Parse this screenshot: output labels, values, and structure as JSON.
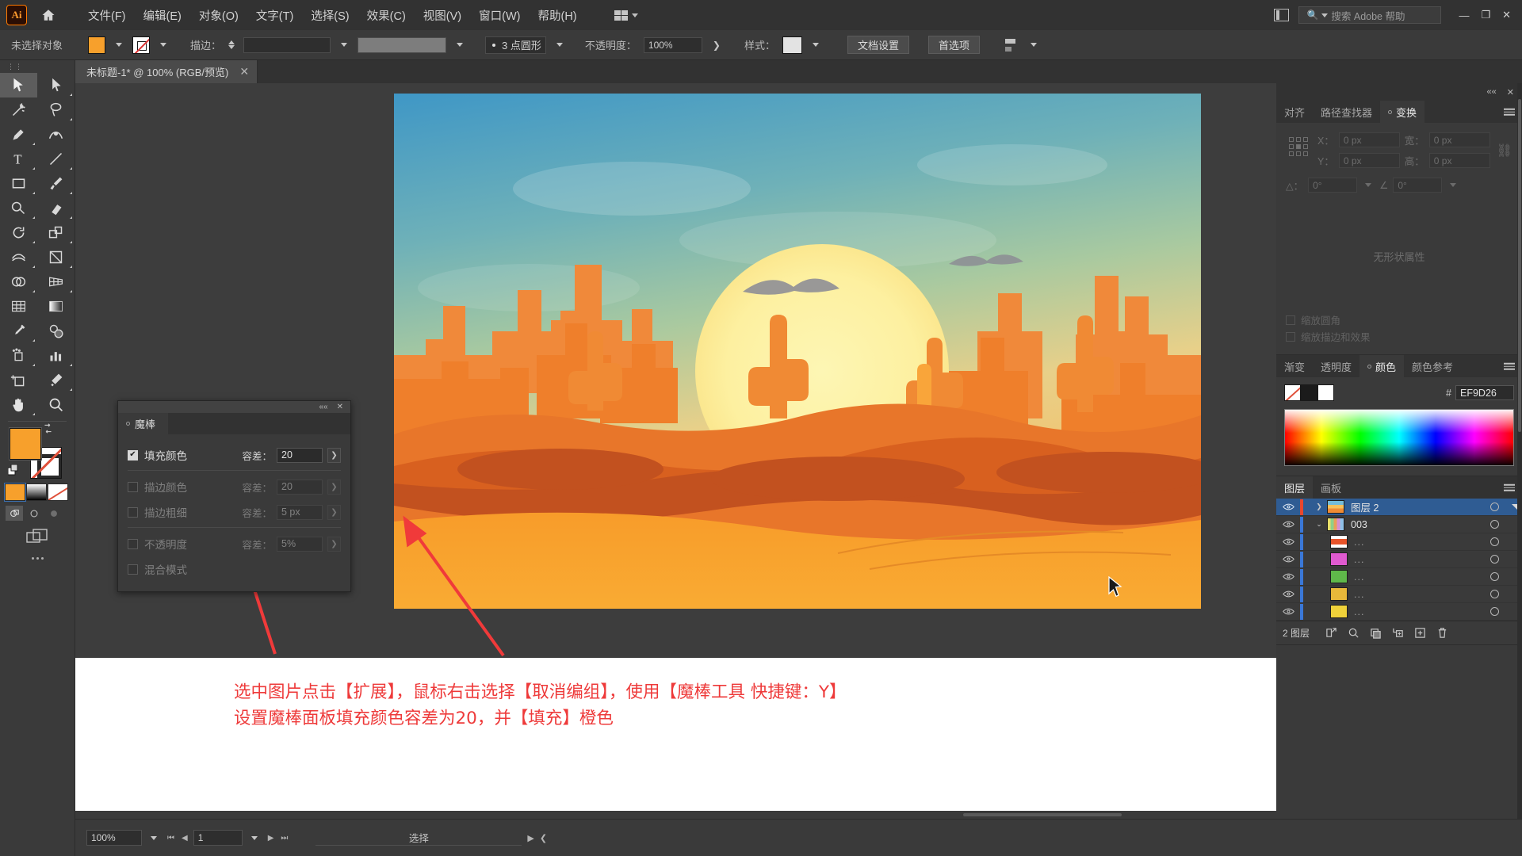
{
  "app": {
    "logo": "Ai",
    "home_icon": "home-icon"
  },
  "menu": {
    "items": [
      {
        "label": "文件(F)"
      },
      {
        "label": "编辑(E)"
      },
      {
        "label": "对象(O)"
      },
      {
        "label": "文字(T)"
      },
      {
        "label": "选择(S)"
      },
      {
        "label": "效果(C)"
      },
      {
        "label": "视图(V)"
      },
      {
        "label": "窗口(W)"
      },
      {
        "label": "帮助(H)"
      }
    ],
    "workspace_switcher": "workspace-switcher"
  },
  "titlebar": {
    "search_placeholder": "搜索 Adobe 帮助",
    "minimize": "—",
    "restore": "❐",
    "close": "✕"
  },
  "control_bar": {
    "selection_status": "未选择对象",
    "fill_color": "#F7A02C",
    "stroke_label": "描边：",
    "stroke_weight": "",
    "profile_label": "3 点圆形",
    "opacity_label": "不透明度：",
    "opacity_value": "100%",
    "style_label": "样式：",
    "document_setup": "文档设置",
    "preferences": "首选项"
  },
  "document_tab": {
    "title": "未标题-1* @ 100% (RGB/预览)",
    "close": "✕"
  },
  "toolbar": {
    "tools": [
      {
        "name": "selection-tool",
        "selected": true
      },
      {
        "name": "direct-selection-tool",
        "selected": false
      },
      {
        "name": "magic-wand-tool",
        "selected": false
      },
      {
        "name": "lasso-tool",
        "selected": false
      },
      {
        "name": "pen-tool",
        "selected": false
      },
      {
        "name": "curvature-tool",
        "selected": false
      },
      {
        "name": "type-tool",
        "selected": false
      },
      {
        "name": "line-segment-tool",
        "selected": false
      },
      {
        "name": "rectangle-tool",
        "selected": false
      },
      {
        "name": "paintbrush-tool",
        "selected": false
      },
      {
        "name": "shaper-tool",
        "selected": false
      },
      {
        "name": "eraser-tool",
        "selected": false
      },
      {
        "name": "rotate-tool",
        "selected": false
      },
      {
        "name": "scale-tool",
        "selected": false
      },
      {
        "name": "width-tool",
        "selected": false
      },
      {
        "name": "free-transform-tool",
        "selected": false
      },
      {
        "name": "shape-builder-tool",
        "selected": false
      },
      {
        "name": "perspective-grid-tool",
        "selected": false
      },
      {
        "name": "mesh-tool",
        "selected": false
      },
      {
        "name": "gradient-tool",
        "selected": false
      },
      {
        "name": "eyedropper-tool",
        "selected": false
      },
      {
        "name": "blend-tool",
        "selected": false
      },
      {
        "name": "symbol-sprayer-tool",
        "selected": false
      },
      {
        "name": "column-graph-tool",
        "selected": false
      },
      {
        "name": "artboard-tool",
        "selected": false
      },
      {
        "name": "slice-tool",
        "selected": false
      },
      {
        "name": "hand-tool",
        "selected": false
      },
      {
        "name": "zoom-tool",
        "selected": false
      }
    ],
    "fill_swatch": "#F7A02C",
    "stroke_swatch": "#FFFFFF",
    "color_modes": [
      "color-fill-mode",
      "gradient-mode",
      "none-mode"
    ],
    "draw_modes": [
      "draw-normal",
      "draw-behind",
      "draw-inside"
    ],
    "screen_mode": "screen-mode-button",
    "more_tools": "•••"
  },
  "magic_wand_panel": {
    "tab_label": "魔棒",
    "collapse_icon": "««",
    "close_icon": "✕",
    "rows": [
      {
        "label": "填充颜色",
        "checked": true,
        "tolerance_label": "容差：",
        "tolerance_value": "20",
        "enabled": true
      },
      {
        "label": "描边颜色",
        "checked": false,
        "tolerance_label": "容差：",
        "tolerance_value": "20",
        "enabled": false
      },
      {
        "label": "描边粗细",
        "checked": false,
        "tolerance_label": "容差：",
        "tolerance_value": "5 px",
        "enabled": false
      },
      {
        "label": "不透明度",
        "checked": false,
        "tolerance_label": "容差：",
        "tolerance_value": "5%",
        "enabled": false
      },
      {
        "label": "混合模式",
        "checked": false,
        "tolerance_label": "",
        "tolerance_value": "",
        "enabled": false
      }
    ]
  },
  "transform_panel": {
    "tabs": [
      {
        "label": "对齐",
        "active": false
      },
      {
        "label": "路径查找器",
        "active": false
      },
      {
        "label": "变换",
        "active": true
      }
    ],
    "x_label": "X：",
    "x_value": "0 px",
    "y_label": "Y：",
    "y_value": "0 px",
    "w_label": "宽：",
    "w_value": "0 px",
    "h_label": "高：",
    "h_value": "0 px",
    "angle_label": "△：",
    "angle_value": "0°",
    "shear_value": "0°",
    "empty_text": "无形状属性",
    "check_scale": "缩放圆角",
    "check_strokes": "缩放描边和效果",
    "link_icon": "constrain-proportions-icon",
    "menu_icon": "panel-menu-icon"
  },
  "color_panel": {
    "tabs": [
      {
        "label": "渐变",
        "active": false
      },
      {
        "label": "透明度",
        "active": false
      },
      {
        "label": "颜色",
        "active": true
      },
      {
        "label": "颜色参考",
        "active": false
      }
    ],
    "hex_symbol": "#",
    "hex_value": "EF9D26",
    "menu_icon": "panel-menu-icon"
  },
  "layers_panel": {
    "tabs": [
      {
        "label": "图层",
        "active": true
      },
      {
        "label": "画板",
        "active": false
      }
    ],
    "rows": [
      {
        "name": "图层 2",
        "selected": true,
        "color": "#e8472e",
        "indent": 0,
        "expandable": true,
        "expanded": false,
        "thumb": "artwork-thumbnail",
        "visible": true
      },
      {
        "name": "003",
        "selected": false,
        "color": "#3a78d8",
        "indent": 1,
        "expandable": true,
        "expanded": true,
        "thumb": "group-thumbnail",
        "visible": true
      },
      {
        "name": "...",
        "selected": false,
        "color": "#3a78d8",
        "indent": 2,
        "expandable": false,
        "expanded": false,
        "thumb": "#e8542a",
        "visible": true
      },
      {
        "name": "...",
        "selected": false,
        "color": "#3a78d8",
        "indent": 2,
        "expandable": false,
        "expanded": false,
        "thumb": "#e05ad0",
        "visible": true
      },
      {
        "name": "...",
        "selected": false,
        "color": "#3a78d8",
        "indent": 2,
        "expandable": false,
        "expanded": false,
        "thumb": "#5fb84a",
        "visible": true
      },
      {
        "name": "...",
        "selected": false,
        "color": "#3a78d8",
        "indent": 2,
        "expandable": false,
        "expanded": false,
        "thumb": "#e8b83a",
        "visible": true
      },
      {
        "name": "...",
        "selected": false,
        "color": "#3a78d8",
        "indent": 2,
        "expandable": false,
        "expanded": false,
        "thumb": "#f0d23a",
        "visible": true
      }
    ],
    "footer_count": "2 图层",
    "footer_buttons": [
      {
        "name": "locate-object-button"
      },
      {
        "name": "make-clipping-mask-button"
      },
      {
        "name": "create-new-sublayer-button"
      },
      {
        "name": "create-new-layer-button"
      },
      {
        "name": "delete-selection-button"
      }
    ]
  },
  "annotation": {
    "line1": "选中图片点击【扩展】，鼠标右击选择【取消编组】，使用【魔棒工具 快捷键：Y】",
    "line2": "设置魔棒面板填充颜色容差为20，并【填充】橙色",
    "color": "#EE3A3A"
  },
  "status_bar": {
    "zoom": "100%",
    "page": "1",
    "status_text": "选择",
    "first_icon": "first-page-icon",
    "prev_icon": "prev-page-icon",
    "next_icon": "next-page-icon",
    "last_icon": "last-page-icon"
  },
  "artwork": {
    "description": "desert-sunset-illustration",
    "sky_top": "#4a9fc4",
    "sky_mid": "#9ec9a8",
    "sun": "#fdf3a8",
    "sand_fore": "#f7a02c",
    "mesa": "#e8762a",
    "dune_dark": "#c2511f"
  }
}
